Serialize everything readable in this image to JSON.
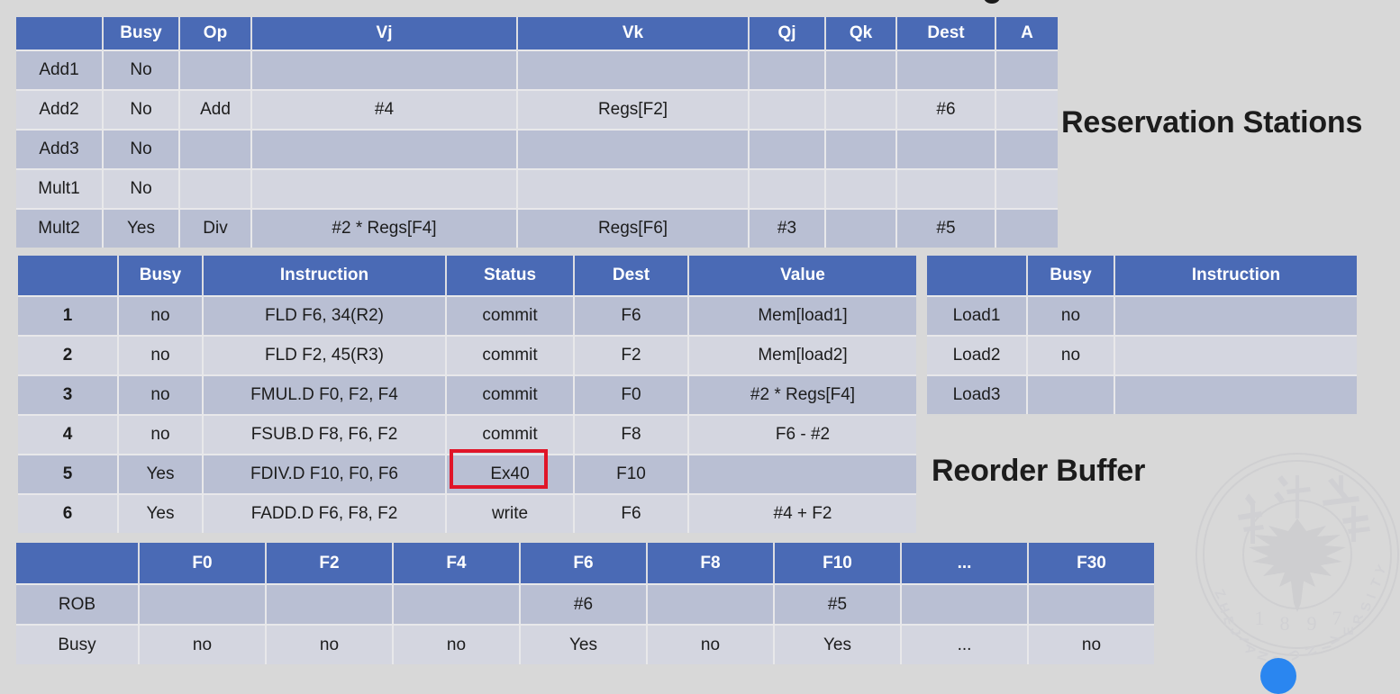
{
  "colors": {
    "background": "#d8d8d8",
    "header_blue": "#4a6ab5",
    "row_dark": "#b9bfd3",
    "row_light": "#d4d6e0",
    "highlight_red": "#e01528",
    "watermark_blue": "#2a86f0"
  },
  "reservation_stations": {
    "label": "Reservation Stations",
    "columns": [
      "",
      "Busy",
      "Op",
      "Vj",
      "Vk",
      "Qj",
      "Qk",
      "Dest",
      "A"
    ],
    "rows": [
      {
        "name": "Add1",
        "busy": "No",
        "op": "",
        "vj": "",
        "vk": "",
        "qj": "",
        "qk": "",
        "dest": "",
        "a": ""
      },
      {
        "name": "Add2",
        "busy": "No",
        "op": "Add",
        "vj": "#4",
        "vk": "Regs[F2]",
        "qj": "",
        "qk": "",
        "dest": "#6",
        "a": ""
      },
      {
        "name": "Add3",
        "busy": "No",
        "op": "",
        "vj": "",
        "vk": "",
        "qj": "",
        "qk": "",
        "dest": "",
        "a": ""
      },
      {
        "name": "Mult1",
        "busy": "No",
        "op": "",
        "vj": "",
        "vk": "",
        "qj": "",
        "qk": "",
        "dest": "",
        "a": ""
      },
      {
        "name": "Mult2",
        "busy": "Yes",
        "op": "Div",
        "vj": "#2 * Regs[F4]",
        "vk": "Regs[F6]",
        "qj": "#3",
        "qk": "",
        "dest": "#5",
        "a": ""
      }
    ]
  },
  "reorder_buffer": {
    "label": "Reorder Buffer",
    "columns": [
      "",
      "Busy",
      "Instruction",
      "Status",
      "Dest",
      "Value"
    ],
    "rows": [
      {
        "entry": "1",
        "busy": "no",
        "instruction": "FLD F6, 34(R2)",
        "status": "commit",
        "dest": "F6",
        "value": "Mem[load1]"
      },
      {
        "entry": "2",
        "busy": "no",
        "instruction": "FLD F2, 45(R3)",
        "status": "commit",
        "dest": "F2",
        "value": "Mem[load2]"
      },
      {
        "entry": "3",
        "busy": "no",
        "instruction": "FMUL.D F0, F2, F4",
        "status": "commit",
        "dest": "F0",
        "value": "#2 * Regs[F4]"
      },
      {
        "entry": "4",
        "busy": "no",
        "instruction": "FSUB.D F8, F6, F2",
        "status": "commit",
        "dest": "F8",
        "value": "F6 - #2"
      },
      {
        "entry": "5",
        "busy": "Yes",
        "instruction": "FDIV.D F10, F0, F6",
        "status": "Ex40",
        "dest": "F10",
        "value": ""
      },
      {
        "entry": "6",
        "busy": "Yes",
        "instruction": "FADD.D F6, F8, F2",
        "status": "write",
        "dest": "F6",
        "value": "#4 + F2"
      }
    ],
    "highlighted_cell": "Ex40"
  },
  "load_buffer": {
    "columns": [
      "",
      "Busy",
      "Instruction"
    ],
    "rows": [
      {
        "name": "Load1",
        "busy": "no",
        "instruction": ""
      },
      {
        "name": "Load2",
        "busy": "no",
        "instruction": ""
      },
      {
        "name": "Load3",
        "busy": "",
        "instruction": ""
      }
    ]
  },
  "register_status": {
    "columns": [
      "",
      "F0",
      "F2",
      "F4",
      "F6",
      "F8",
      "F10",
      "...",
      "F30"
    ],
    "rows": [
      {
        "name": "ROB",
        "values": [
          "",
          "",
          "",
          "#6",
          "",
          "#5",
          "",
          ""
        ]
      },
      {
        "name": "Busy",
        "values": [
          "no",
          "no",
          "no",
          "Yes",
          "no",
          "Yes",
          "...",
          "no"
        ]
      }
    ]
  },
  "watermark": {
    "institution": "ZHEJIANG UNIVERSITY",
    "year": "1897"
  }
}
